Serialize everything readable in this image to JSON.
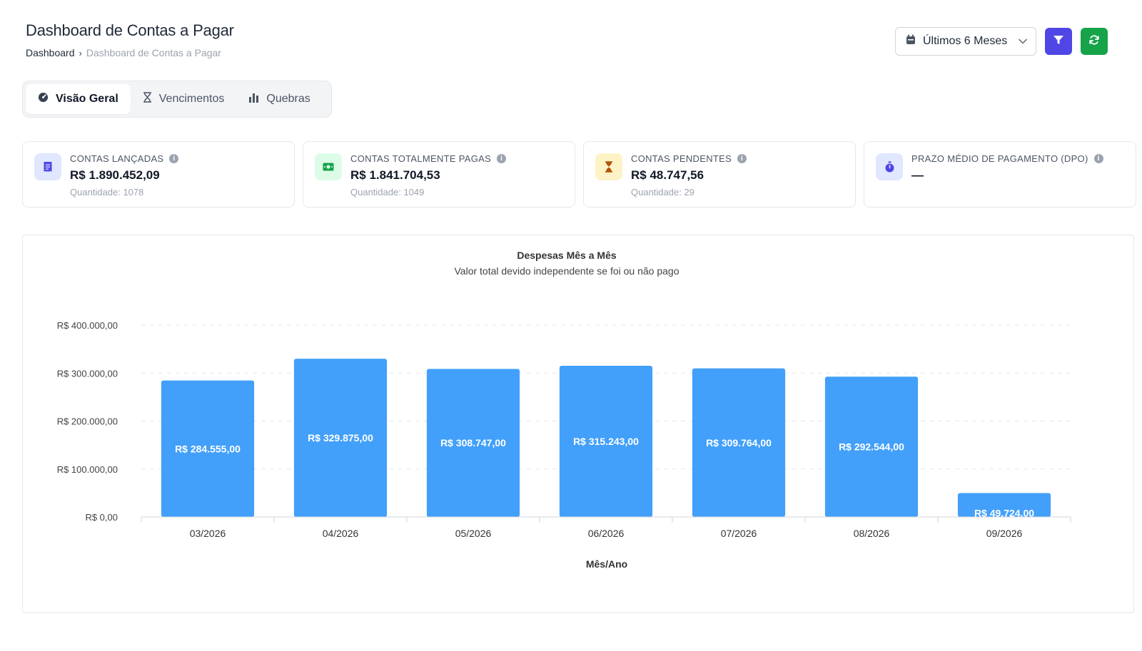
{
  "header": {
    "title": "Dashboard de Contas a Pagar",
    "breadcrumb": {
      "root": "Dashboard",
      "separator": "›",
      "current": "Dashboard de Contas a Pagar"
    }
  },
  "toolbar": {
    "period": "Últimos 6 Meses",
    "filter_icon": "filter-icon",
    "refresh_icon": "refresh-icon"
  },
  "tabs": [
    {
      "label": "Visão Geral",
      "icon": "dashboard-icon",
      "active": true
    },
    {
      "label": "Vencimentos",
      "icon": "hourglass-icon",
      "active": false
    },
    {
      "label": "Quebras",
      "icon": "bar-chart-icon",
      "active": false
    }
  ],
  "kpis": [
    {
      "label": "CONTAS LANÇADAS",
      "value": "R$ 1.890.452,09",
      "sub": "Quantidade: 1078",
      "icon": "receipt-icon",
      "color": "#4f46e5",
      "bg": "#e0e7ff"
    },
    {
      "label": "CONTAS TOTALMENTE PAGAS",
      "value": "R$ 1.841.704,53",
      "sub": "Quantidade: 1049",
      "icon": "money-icon",
      "color": "#16a34a",
      "bg": "#dcfce7"
    },
    {
      "label": "CONTAS PENDENTES",
      "value": "R$ 48.747,56",
      "sub": "Quantidade: 29",
      "icon": "hourglass-icon",
      "color": "#b45309",
      "bg": "#fef3c7"
    },
    {
      "label": "PRAZO MÉDIO DE PAGAMENTO (DPO)",
      "value": "—",
      "sub": "",
      "icon": "stopwatch-icon",
      "color": "#4f46e5",
      "bg": "#e0e7ff"
    }
  ],
  "chart_data": {
    "type": "bar",
    "title": "Despesas Mês a Mês",
    "subtitle": "Valor total devido independente se foi ou não pago",
    "xlabel": "Mês/Ano",
    "ylabel": "",
    "categories": [
      "03/2026",
      "04/2026",
      "05/2026",
      "06/2026",
      "07/2026",
      "08/2026",
      "09/2026"
    ],
    "values": [
      284555,
      329875,
      308747,
      315243,
      309764,
      292544,
      49724
    ],
    "value_labels": [
      "R$ 284.555,00",
      "R$ 329.875,00",
      "R$ 308.747,00",
      "R$ 315.243,00",
      "R$ 309.764,00",
      "R$ 292.544,00",
      "R$ 49.724,00"
    ],
    "yticks": [
      0,
      100000,
      200000,
      300000,
      400000
    ],
    "ytick_labels": [
      "R$ 0,00",
      "R$ 100.000,00",
      "R$ 200.000,00",
      "R$ 300.000,00",
      "R$ 400.000,00"
    ],
    "ylim": [
      0,
      400000
    ],
    "grid": true,
    "bar_color": "#42a0fa"
  }
}
